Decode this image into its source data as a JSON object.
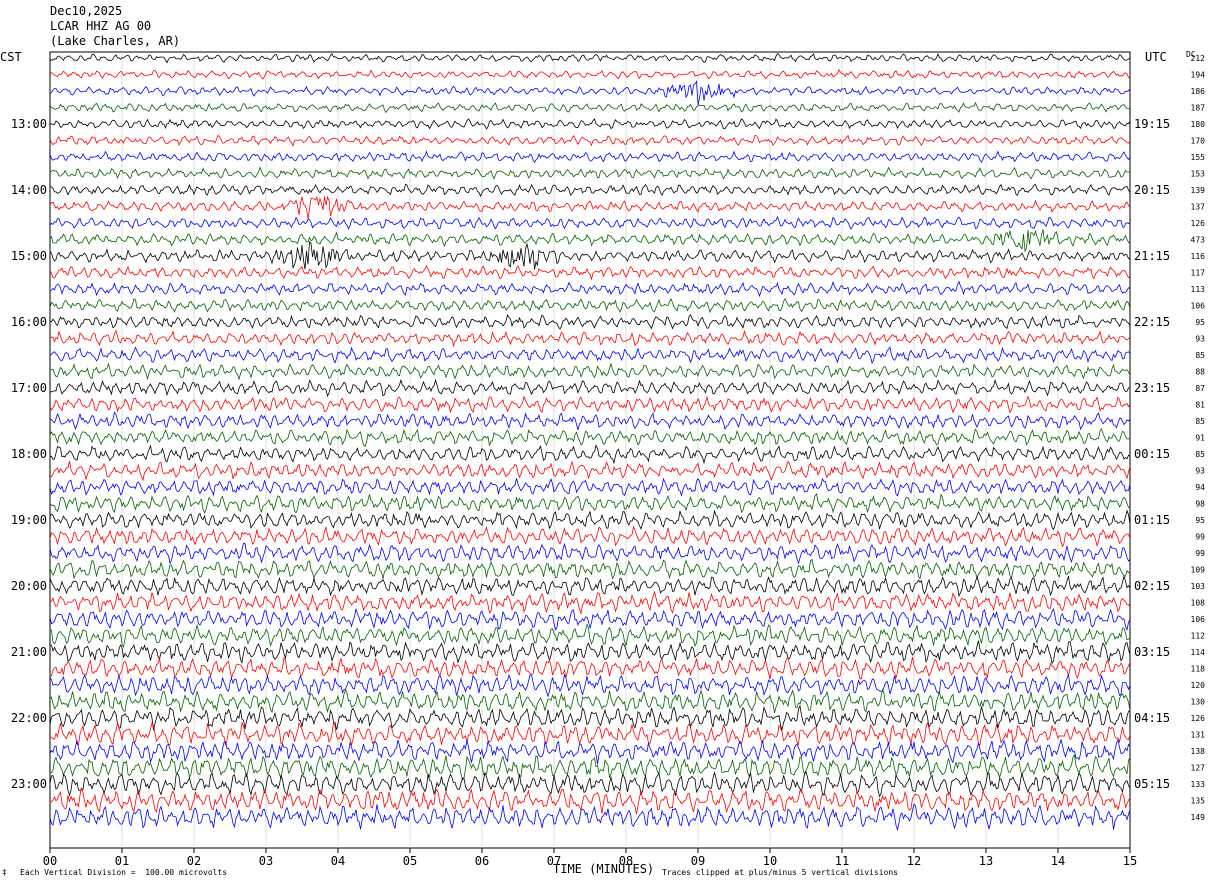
{
  "header": {
    "date": "Dec10,2025",
    "station": "LCAR HHZ AG 00",
    "location": "(Lake Charles, AR)"
  },
  "left_tz": "CST",
  "right_tz": "UTC",
  "dc_header": "DC",
  "footer": {
    "scale": "Each Vertical Division =  100.00 microvolts",
    "clip": "Traces clipped at plus/minus 5 vertical divisions",
    "mark": "‡"
  },
  "chart_data": {
    "type": "line",
    "title": "",
    "xlabel": "TIME (MINUTES)",
    "xlim": [
      0,
      15
    ],
    "x_ticks": [
      "00",
      "01",
      "02",
      "03",
      "04",
      "05",
      "06",
      "07",
      "08",
      "09",
      "10",
      "11",
      "12",
      "13",
      "14",
      "15"
    ],
    "left_hour_labels": [
      "13:00",
      "14:00",
      "15:00",
      "16:00",
      "17:00",
      "18:00",
      "19:00",
      "20:00",
      "21:00",
      "22:00",
      "23:00"
    ],
    "right_hour_labels": [
      "19:15",
      "20:15",
      "21:15",
      "22:15",
      "23:15",
      "00:15",
      "01:15",
      "02:15",
      "03:15",
      "04:15",
      "05:15"
    ],
    "trace_colors": [
      "#000000",
      "#ff0000",
      "#0000ff",
      "#006400"
    ],
    "dc_offsets": [
      212,
      194,
      186,
      187,
      180,
      170,
      155,
      153,
      139,
      137,
      126,
      473,
      116,
      117,
      113,
      106,
      95,
      93,
      85,
      88,
      87,
      81,
      85,
      91,
      85,
      93,
      94,
      98,
      95,
      99,
      99,
      109,
      103,
      108,
      106,
      112,
      114,
      118,
      120,
      130,
      126,
      131,
      138,
      127,
      133,
      135,
      149
    ],
    "events": [
      {
        "trace": 2,
        "minute": 9.0,
        "label": ""
      },
      {
        "trace": 9,
        "minute": 3.7,
        "label": ""
      },
      {
        "trace": 11,
        "minute": 13.5,
        "label": ""
      },
      {
        "trace": 12,
        "minute": 3.6,
        "label": ""
      },
      {
        "trace": 12,
        "minute": 6.6,
        "label": ""
      }
    ]
  }
}
